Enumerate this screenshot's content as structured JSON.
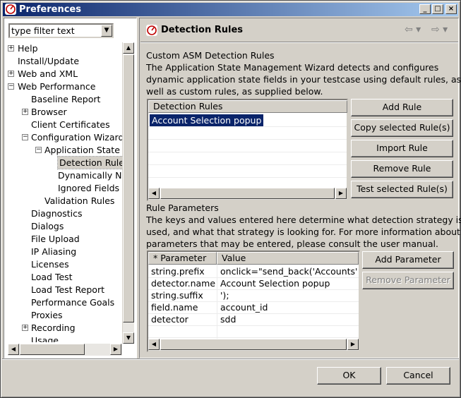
{
  "window": {
    "title": "Preferences",
    "minimize_label": "_",
    "maximize_label": "□",
    "close_label": "×"
  },
  "filter": {
    "value": "type filter text",
    "arrow": "▼"
  },
  "tree": [
    {
      "label": "Help",
      "expander": "+",
      "level": 0
    },
    {
      "label": "Install/Update",
      "expander": "",
      "level": 0
    },
    {
      "label": "Web and XML",
      "expander": "+",
      "level": 0
    },
    {
      "label": "Web Performance",
      "expander": "−",
      "level": 0
    },
    {
      "label": "Baseline Report",
      "expander": "",
      "level": 1
    },
    {
      "label": "Browser",
      "expander": "+",
      "level": 1
    },
    {
      "label": "Client Certificates",
      "expander": "",
      "level": 1
    },
    {
      "label": "Configuration Wizard",
      "expander": "−",
      "level": 1
    },
    {
      "label": "Application State",
      "expander": "−",
      "level": 2
    },
    {
      "label": "Detection Rule",
      "expander": "",
      "level": 3,
      "selected": true
    },
    {
      "label": "Dynamically N",
      "expander": "",
      "level": 3
    },
    {
      "label": "Ignored Fields",
      "expander": "",
      "level": 3
    },
    {
      "label": "Validation Rules",
      "expander": "",
      "level": 2
    },
    {
      "label": "Diagnostics",
      "expander": "",
      "level": 1
    },
    {
      "label": "Dialogs",
      "expander": "",
      "level": 1
    },
    {
      "label": "File Upload",
      "expander": "",
      "level": 1
    },
    {
      "label": "IP Aliasing",
      "expander": "",
      "level": 1
    },
    {
      "label": "Licenses",
      "expander": "",
      "level": 1
    },
    {
      "label": "Load Test",
      "expander": "",
      "level": 1
    },
    {
      "label": "Load Test Report",
      "expander": "",
      "level": 1
    },
    {
      "label": "Performance Goals",
      "expander": "",
      "level": 1
    },
    {
      "label": "Proxies",
      "expander": "",
      "level": 1
    },
    {
      "label": "Recording",
      "expander": "+",
      "level": 1
    },
    {
      "label": "Usage",
      "expander": "",
      "level": 1
    }
  ],
  "page": {
    "title": "Detection Rules",
    "back_arrow": "⇦ ▾",
    "forward_arrow": "⇨ ▾",
    "rules_heading": "Custom ASM Detection Rules",
    "rules_desc_1": "The Application State Management Wizard detects and configures",
    "rules_desc_2": "dynamic application state fields in your testcase using default rules, as",
    "rules_desc_3": "well as custom rules, as supplied below.",
    "rules_table": {
      "header": "Detection Rules",
      "rows": [
        "Account Selection popup"
      ]
    },
    "rule_buttons": {
      "add": "Add Rule",
      "copy": "Copy selected Rule(s)",
      "import": "Import Rule",
      "remove": "Remove Rule",
      "test": "Test selected Rule(s)"
    },
    "params_heading": "Rule Parameters",
    "params_desc_1": "The keys and values entered here determine what detection strategy is",
    "params_desc_2": "used, and what that strategy is looking for. For more information about",
    "params_desc_3": "parameters that may be entered, please consult the user manual.",
    "params_table": {
      "headers": [
        "* Parameter",
        "Value"
      ],
      "rows": [
        [
          "string.prefix",
          "onclick=\"send_back('Accounts','"
        ],
        [
          "detector.name",
          "Account Selection popup"
        ],
        [
          "string.suffix",
          "');"
        ],
        [
          "field.name",
          "account_id"
        ],
        [
          "detector",
          "sdd"
        ]
      ]
    },
    "param_buttons": {
      "add": "Add Parameter",
      "remove": "Remove Parameter"
    }
  },
  "dialog_buttons": {
    "ok": "OK",
    "cancel": "Cancel"
  },
  "scroll": {
    "up": "▲",
    "down": "▼",
    "left": "◀",
    "right": "▶"
  },
  "colors": {
    "titlebar_start": "#0a246a",
    "titlebar_end": "#a6caf0",
    "selection": "#0a246a"
  }
}
